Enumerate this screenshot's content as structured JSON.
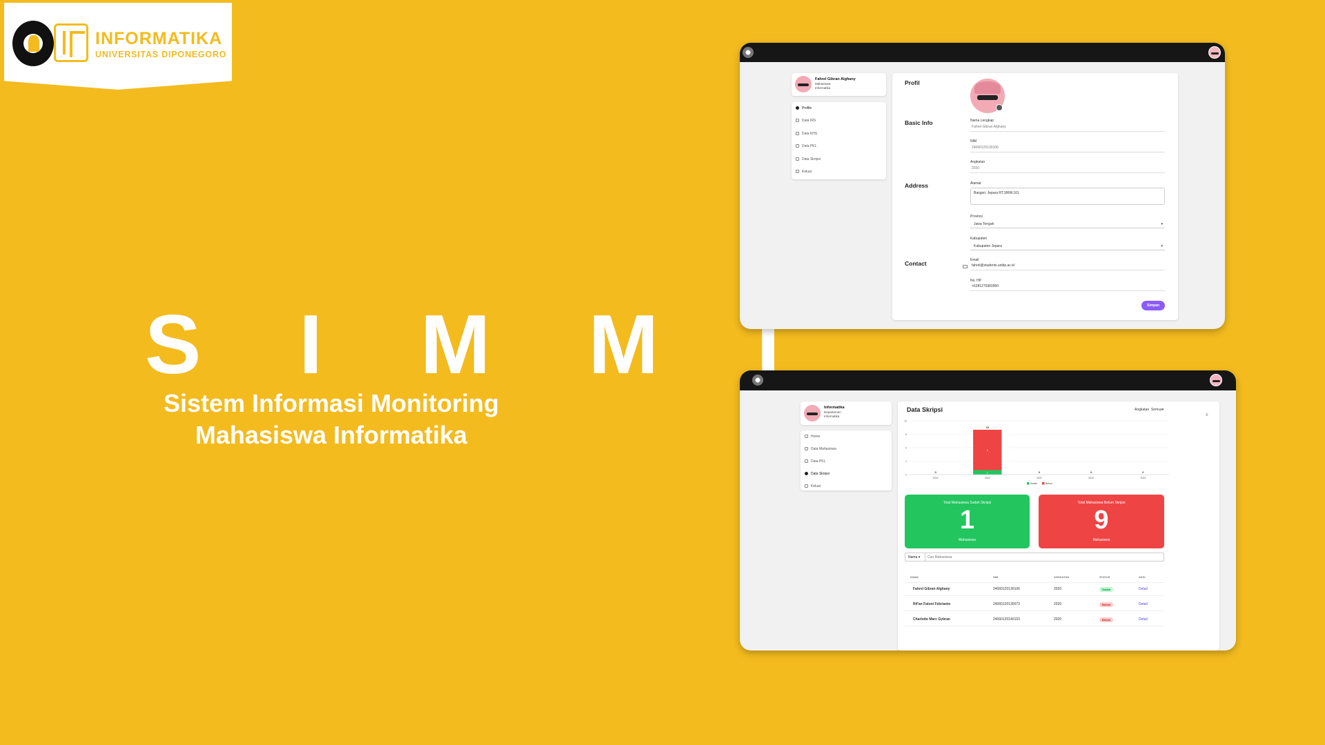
{
  "brand": {
    "title": "INFORMATIKA",
    "subtitle": "UNIVERSITAS DIPONEGORO"
  },
  "hero": {
    "title": "S I M M I",
    "subtitle_line1": "Sistem Informasi Monitoring",
    "subtitle_line2": "Mahasiswa Informatika"
  },
  "profile_window": {
    "user": {
      "name": "Fahrel Gibran Alghany",
      "role": "Mahasiswa",
      "dept": "Informatika"
    },
    "menu": [
      "Profile",
      "Data IRS",
      "Data KHS",
      "Data PKL",
      "Data Skripsi",
      "Keluar"
    ],
    "sections": {
      "profil": "Profil",
      "basic": "Basic Info",
      "address": "Address",
      "contact": "Contact"
    },
    "fields": {
      "nama_label": "Nama Lengkap",
      "nama_value": "Fahrel Gibran Alghany",
      "nim_label": "NIM",
      "nim_value": "24060120130106",
      "angkatan_label": "Angkatan",
      "angkatan_value": "2020",
      "alamat_label": "Alamat",
      "alamat_value": "Bangsri, Jepara RT.3/RW.101",
      "provinsi_label": "Provinsi",
      "provinsi_value": "Jawa Tengah",
      "kabupaten_label": "Kabupaten",
      "kabupaten_value": "Kabupaten Jepara",
      "email_label": "Email",
      "email_value": "fahrel@students.undip.ac.id",
      "hp_label": "No. HP",
      "hp_value": "+6281270360950"
    },
    "save_label": "Simpan"
  },
  "skripsi_window": {
    "user": {
      "name": "Informatika",
      "role": "Departemen",
      "dept": "Informatika"
    },
    "menu": [
      "Home",
      "Data Mahasiswa",
      "Data PKL",
      "Data Skripsi",
      "Keluar"
    ],
    "title": "Data Skripsi",
    "filter_label": "Angkatan",
    "filter_value": "Semua",
    "stats": [
      {
        "label": "Total Mahasiswa Sudah Skripsi",
        "value": "1",
        "unit": "Mahasiswa",
        "color": "#22c55e"
      },
      {
        "label": "Total Mahasiswa Belum Skripsi",
        "value": "9",
        "unit": "Mahasiswa",
        "color": "#ef4444"
      }
    ],
    "search": {
      "select_value": "Nama",
      "placeholder": "Cari Mahasiswa"
    },
    "table": {
      "headers": [
        "NAMA",
        "NIM",
        "ANGKATAN",
        "STATUS",
        "AKSI"
      ],
      "rows": [
        {
          "nama": "Fahrel Gibran Alghany",
          "nim": "24060120130106",
          "angkatan": "2020",
          "status": "Sudah",
          "aksi": "Detail"
        },
        {
          "nama": "Rif'an Fatoni Febrianto",
          "nim": "24060120130073",
          "angkatan": "2020",
          "status": "Belum",
          "aksi": "Detail"
        },
        {
          "nama": "Charlotte Marc Gybran",
          "nim": "24060120140153",
          "angkatan": "2020",
          "status": "Belum",
          "aksi": "Detail"
        }
      ]
    }
  },
  "chart_data": {
    "type": "bar",
    "stacked": true,
    "categories": [
      "2019",
      "2020",
      "2021",
      "2022",
      "2023"
    ],
    "series": [
      {
        "name": "Sudah",
        "values": [
          0,
          1,
          0,
          0,
          0
        ],
        "color": "#22c55e"
      },
      {
        "name": "Belum",
        "values": [
          0,
          9,
          0,
          0,
          0
        ],
        "color": "#ef4444"
      }
    ],
    "totals": [
      0,
      10,
      0,
      0,
      0
    ],
    "y_ticks": [
      "0",
      "2",
      "5",
      "8",
      "10"
    ],
    "ylim": [
      0,
      12
    ],
    "legend": "bottom"
  }
}
